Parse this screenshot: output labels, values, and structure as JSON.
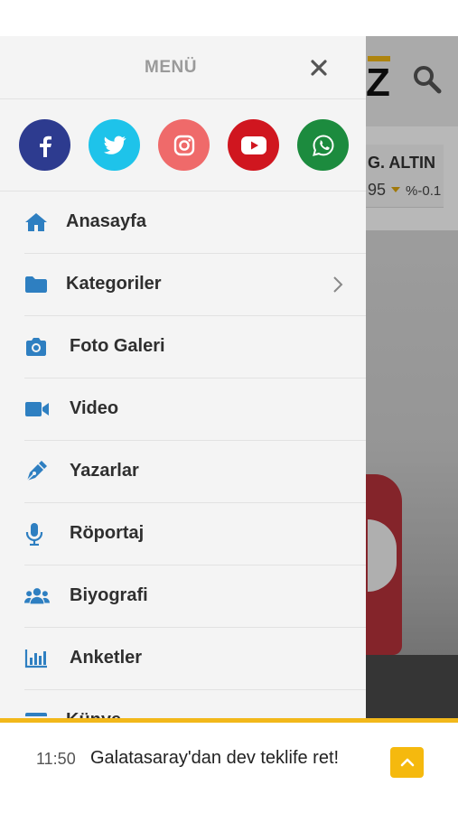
{
  "background": {
    "logo_letter": "Z",
    "ticker": {
      "name": "G. ALTIN",
      "value": "95",
      "change": "%-0.1"
    }
  },
  "drawer": {
    "title": "MENÜ",
    "social": [
      {
        "icon": "facebook-icon",
        "color": "#2d3b8f"
      },
      {
        "icon": "twitter-icon",
        "color": "#1ec3ea"
      },
      {
        "icon": "instagram-icon",
        "color": "#ef6a6a"
      },
      {
        "icon": "youtube-icon",
        "color": "#d0161f"
      },
      {
        "icon": "whatsapp-icon",
        "color": "#1c8b3e"
      }
    ],
    "items": [
      {
        "label": "Anasayfa",
        "icon": "home-icon"
      },
      {
        "label": "Kategoriler",
        "icon": "folder-icon",
        "has_submenu": true
      },
      {
        "label": "Foto Galeri",
        "icon": "camera-icon"
      },
      {
        "label": "Video",
        "icon": "video-icon"
      },
      {
        "label": "Yazarlar",
        "icon": "pen-icon"
      },
      {
        "label": "Röportaj",
        "icon": "microphone-icon"
      },
      {
        "label": "Biyografi",
        "icon": "users-icon"
      },
      {
        "label": "Anketler",
        "icon": "poll-icon"
      },
      {
        "label": "Künye",
        "icon": "card-icon"
      }
    ]
  },
  "newsbar": {
    "time": "11:50",
    "headline": "Galatasaray'dan dev teklife ret!"
  },
  "colors": {
    "accent": "#f2b81a",
    "icon_blue": "#2e7fc1"
  }
}
